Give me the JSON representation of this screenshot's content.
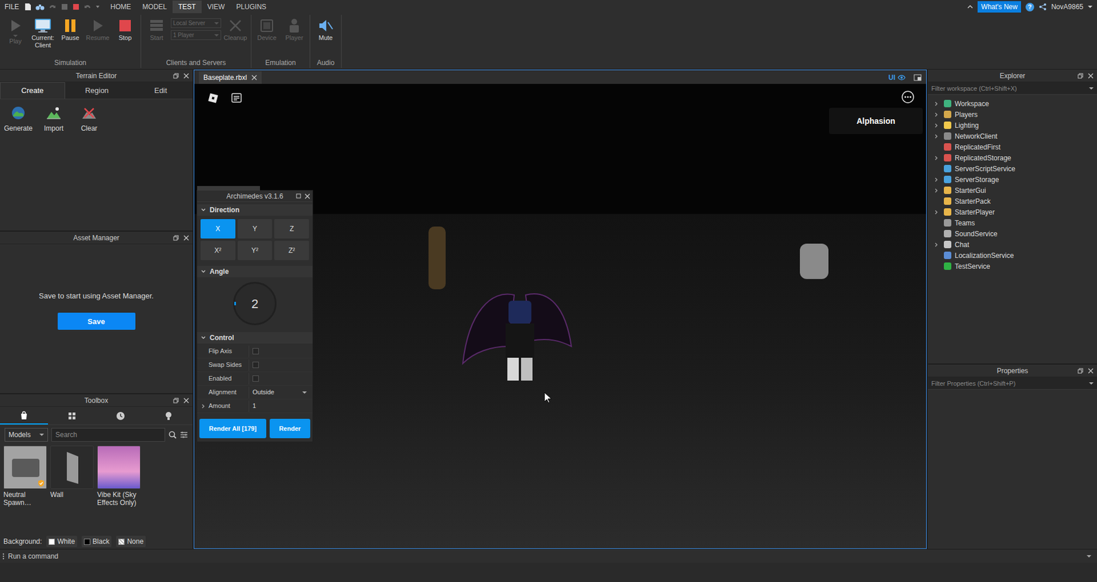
{
  "menu_bar": {
    "file": "FILE",
    "tabs": [
      {
        "label": "HOME",
        "selected": false
      },
      {
        "label": "MODEL",
        "selected": false
      },
      {
        "label": "TEST",
        "selected": true
      },
      {
        "label": "VIEW",
        "selected": false
      },
      {
        "label": "PLUGINS",
        "selected": false
      }
    ],
    "whats_new": "What's New",
    "help": "?",
    "user": "NovA9865"
  },
  "ribbon": {
    "groups": [
      {
        "title": "Simulation",
        "tools": [
          {
            "kind": "play",
            "lines": [
              "Play"
            ],
            "disabled": true
          },
          {
            "kind": "client",
            "lines": [
              "Current:",
              "Client"
            ],
            "disabled": false
          },
          {
            "kind": "pause",
            "lines": [
              "Pause"
            ],
            "disabled": false
          },
          {
            "kind": "resume",
            "lines": [
              "Resume"
            ],
            "disabled": true
          },
          {
            "kind": "stop",
            "lines": [
              "Stop"
            ],
            "disabled": false
          }
        ]
      },
      {
        "title": "Clients and Servers",
        "tools": [
          {
            "kind": "start",
            "lines": [
              "Start"
            ],
            "disabled": true
          },
          {
            "kind": "dropdowns",
            "lines": [
              "Local Server",
              "1 Player"
            ],
            "disabled": true
          },
          {
            "kind": "cleanup",
            "lines": [
              "Cleanup"
            ],
            "disabled": true
          }
        ]
      },
      {
        "title": "Emulation",
        "tools": [
          {
            "kind": "device",
            "lines": [
              "Device"
            ],
            "disabled": true
          },
          {
            "kind": "player",
            "lines": [
              "Player"
            ],
            "disabled": true
          }
        ]
      },
      {
        "title": "Audio",
        "tools": [
          {
            "kind": "mute",
            "lines": [
              "Mute"
            ],
            "disabled": false
          }
        ]
      }
    ]
  },
  "terrain_editor": {
    "title": "Terrain Editor",
    "tabs": [
      {
        "label": "Create",
        "selected": true
      },
      {
        "label": "Region",
        "selected": false
      },
      {
        "label": "Edit",
        "selected": false
      }
    ],
    "tools": [
      {
        "kind": "generate",
        "label": "Generate"
      },
      {
        "kind": "import",
        "label": "Import"
      },
      {
        "kind": "clear",
        "label": "Clear"
      }
    ]
  },
  "asset_manager": {
    "title": "Asset Manager",
    "message": "Save to start using Asset Manager.",
    "button": "Save"
  },
  "toolbox": {
    "title": "Toolbox",
    "tabs": [
      {
        "kind": "marketplace",
        "selected": true
      },
      {
        "kind": "inventory",
        "selected": false
      },
      {
        "kind": "recent",
        "selected": false
      },
      {
        "kind": "creations",
        "selected": false
      }
    ],
    "category": "Models",
    "search_placeholder": "Search",
    "items": [
      {
        "label": "Neutral Spawn…",
        "color": "#a3a3a3",
        "verified": true
      },
      {
        "label": "Wall",
        "color": "#2b2b2b",
        "verified": false
      },
      {
        "label": "Vibe Kit (Sky Effects Only)",
        "color": "#b86bb8",
        "verified": false
      }
    ],
    "background": {
      "label": "Background:",
      "options": [
        {
          "kind": "white",
          "label": "White"
        },
        {
          "kind": "black",
          "label": "Black"
        },
        {
          "kind": "none",
          "label": "None"
        }
      ]
    }
  },
  "viewport": {
    "tab": "Baseplate.rbxl",
    "ui_toggle": "UI",
    "ui_visible": true,
    "player_list": [
      "Alphasion"
    ]
  },
  "archimedes": {
    "title": "Archimedes v3.1.6",
    "direction": {
      "header": "Direction",
      "expanded": true,
      "buttons": [
        {
          "label": "X",
          "selected": true
        },
        {
          "label": "Y",
          "selected": false
        },
        {
          "label": "Z",
          "selected": false
        },
        {
          "label": "X²",
          "selected": false
        },
        {
          "label": "Y²",
          "selected": false
        },
        {
          "label": "Z²",
          "selected": false
        }
      ]
    },
    "angle": {
      "header": "Angle",
      "expanded": true,
      "value": "2"
    },
    "control": {
      "header": "Control",
      "expanded": true,
      "rows": [
        {
          "kind": "checkbox",
          "label": "Flip Axis",
          "checked": false
        },
        {
          "kind": "checkbox",
          "label": "Swap Sides",
          "checked": false
        },
        {
          "kind": "checkbox",
          "label": "Enabled",
          "checked": false
        },
        {
          "kind": "dropdown",
          "label": "Alignment",
          "value": "Outside"
        },
        {
          "kind": "input",
          "label": "Amount",
          "value": "1",
          "expanded": false
        }
      ]
    },
    "buttons": [
      "Render All [179]",
      "Render"
    ]
  },
  "explorer": {
    "title": "Explorer",
    "filter_placeholder": "Filter workspace (Ctrl+Shift+X)",
    "items": [
      {
        "name": "Workspace",
        "has_children": true,
        "expanded": false,
        "color": "#3fb37f"
      },
      {
        "name": "Players",
        "has_children": true,
        "expanded": false,
        "color": "#d4a84b"
      },
      {
        "name": "Lighting",
        "has_children": true,
        "expanded": false,
        "color": "#f2c94c"
      },
      {
        "name": "NetworkClient",
        "has_children": true,
        "expanded": false,
        "color": "#8a8a8a"
      },
      {
        "name": "ReplicatedFirst",
        "has_children": false,
        "expanded": false,
        "color": "#d9534f"
      },
      {
        "name": "ReplicatedStorage",
        "has_children": true,
        "expanded": false,
        "color": "#d9534f"
      },
      {
        "name": "ServerScriptService",
        "has_children": false,
        "expanded": false,
        "color": "#4aa3df"
      },
      {
        "name": "ServerStorage",
        "has_children": true,
        "expanded": false,
        "color": "#4aa3df"
      },
      {
        "name": "StarterGui",
        "has_children": true,
        "expanded": false,
        "color": "#e8b54a"
      },
      {
        "name": "StarterPack",
        "has_children": false,
        "expanded": false,
        "color": "#e8b54a"
      },
      {
        "name": "StarterPlayer",
        "has_children": true,
        "expanded": false,
        "color": "#e8b54a"
      },
      {
        "name": "Teams",
        "has_children": false,
        "expanded": false,
        "color": "#9a9a9a"
      },
      {
        "name": "SoundService",
        "has_children": false,
        "expanded": false,
        "color": "#b0b0b0"
      },
      {
        "name": "Chat",
        "has_children": true,
        "expanded": false,
        "color": "#c8c8c8"
      },
      {
        "name": "LocalizationService",
        "has_children": false,
        "expanded": false,
        "color": "#5b8dd6"
      },
      {
        "name": "TestService",
        "has_children": false,
        "expanded": false,
        "color": "#2fb344"
      }
    ]
  },
  "properties": {
    "title": "Properties",
    "filter_placeholder": "Filter Properties (Ctrl+Shift+P)"
  },
  "command_bar": {
    "placeholder": "Run a command"
  }
}
